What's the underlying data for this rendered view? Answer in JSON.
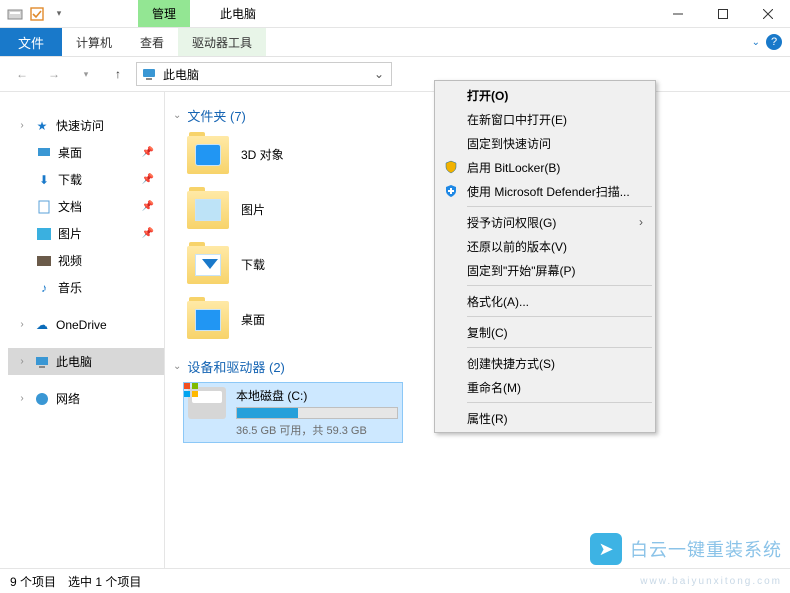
{
  "titlebar": {
    "manage_tab": "管理",
    "title": "此电脑"
  },
  "ribbon": {
    "file": "文件",
    "tabs": [
      "计算机",
      "查看"
    ],
    "tool_tab": "驱动器工具"
  },
  "addressbar": {
    "text": "此电脑"
  },
  "sidebar": {
    "quick_access": "快速访问",
    "desktop": "桌面",
    "downloads": "下载",
    "documents": "文档",
    "pictures": "图片",
    "videos": "视频",
    "music": "音乐",
    "onedrive": "OneDrive",
    "this_pc": "此电脑",
    "network": "网络"
  },
  "groups": {
    "folders_header": "文件夹 (7)",
    "drives_header": "设备和驱动器 (2)"
  },
  "folders": {
    "objects3d": "3D 对象",
    "pictures": "图片",
    "downloads": "下载",
    "desktop": "桌面"
  },
  "drive": {
    "name": "本地磁盘 (C:)",
    "subtitle": "36.5 GB 可用，共 59.3 GB"
  },
  "context_menu": {
    "open": "打开(O)",
    "open_new_window": "在新窗口中打开(E)",
    "pin_quick_access": "固定到快速访问",
    "bitlocker": "启用 BitLocker(B)",
    "defender": "使用 Microsoft Defender扫描...",
    "grant_access": "授予访问权限(G)",
    "restore_previous": "还原以前的版本(V)",
    "pin_start": "固定到\"开始\"屏幕(P)",
    "format": "格式化(A)...",
    "copy": "复制(C)",
    "create_shortcut": "创建快捷方式(S)",
    "rename": "重命名(M)",
    "properties": "属性(R)"
  },
  "statusbar": {
    "items": "9 个项目",
    "selected": "选中 1 个项目"
  },
  "watermark": {
    "text": "白云一键重装系统",
    "sub": "www.baiyunxitong.com"
  }
}
